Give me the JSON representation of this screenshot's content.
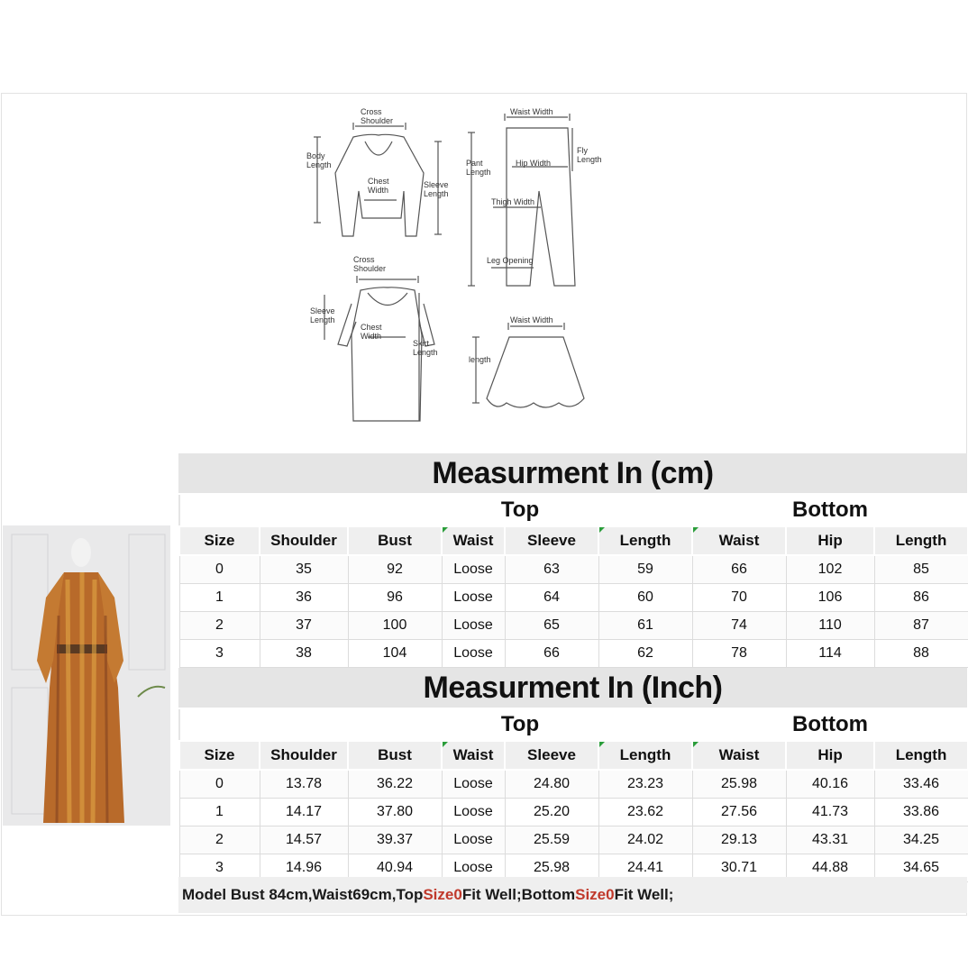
{
  "diagram_labels": {
    "cross_shoulder_1": "Cross",
    "cross_shoulder_2": "Shoulder",
    "body_length_1": "Body",
    "body_length_2": "Length",
    "chest_width_1": "Chest",
    "chest_width_2": "Width",
    "sleeve_length_1": "Sleeve",
    "sleeve_length_2": "Length",
    "waist_width": "Waist Width",
    "pant_length_1": "Pant",
    "pant_length_2": "Length",
    "hip_width": "Hip Width",
    "fly_length_1": "Fly",
    "fly_length_2": "Length",
    "thigh_width": "Thigh Width",
    "leg_opening": "Leg Opening",
    "dress_cross_1": "Cross",
    "dress_cross_2": "Shoulder",
    "dress_sleeve_1": "Sleeve",
    "dress_sleeve_2": "Length",
    "dress_chest_1": "Chest",
    "dress_chest_2": "Width",
    "skirt_length_1": "Skirt",
    "skirt_length_2": "Length",
    "skirt_waist": "Waist Width",
    "skirt_len": "length"
  },
  "columns": [
    "Size",
    "Shoulder",
    "Bust",
    "Waist",
    "Sleeve",
    "Length",
    "Waist",
    "Hip",
    "Length"
  ],
  "group_top": "Top",
  "group_bottom": "Bottom",
  "cm": {
    "title": "Measurment In (cm)",
    "rows": [
      [
        "0",
        "35",
        "92",
        "Loose",
        "63",
        "59",
        "66",
        "102",
        "85"
      ],
      [
        "1",
        "36",
        "96",
        "Loose",
        "64",
        "60",
        "70",
        "106",
        "86"
      ],
      [
        "2",
        "37",
        "100",
        "Loose",
        "65",
        "61",
        "74",
        "110",
        "87"
      ],
      [
        "3",
        "38",
        "104",
        "Loose",
        "66",
        "62",
        "78",
        "114",
        "88"
      ]
    ]
  },
  "inch": {
    "title": "Measurment In (Inch)",
    "rows": [
      [
        "0",
        "13.78",
        "36.22",
        "Loose",
        "24.80",
        "23.23",
        "25.98",
        "40.16",
        "33.46"
      ],
      [
        "1",
        "14.17",
        "37.80",
        "Loose",
        "25.20",
        "23.62",
        "27.56",
        "41.73",
        "33.86"
      ],
      [
        "2",
        "14.57",
        "39.37",
        "Loose",
        "25.59",
        "24.02",
        "29.13",
        "43.31",
        "34.25"
      ],
      [
        "3",
        "14.96",
        "40.94",
        "Loose",
        "25.98",
        "24.41",
        "30.71",
        "44.88",
        "34.65"
      ]
    ]
  },
  "note": {
    "part1": "Model Bust 84cm,Waist69cm,Top ",
    "size1": "Size0",
    "part2": " Fit Well;Bottom ",
    "size2": "Size0",
    "part3": " Fit Well;"
  },
  "colors": {
    "accent_red": "#c0392b",
    "header_gray": "#e5e5e5",
    "mark_green": "#2a9d3a"
  }
}
